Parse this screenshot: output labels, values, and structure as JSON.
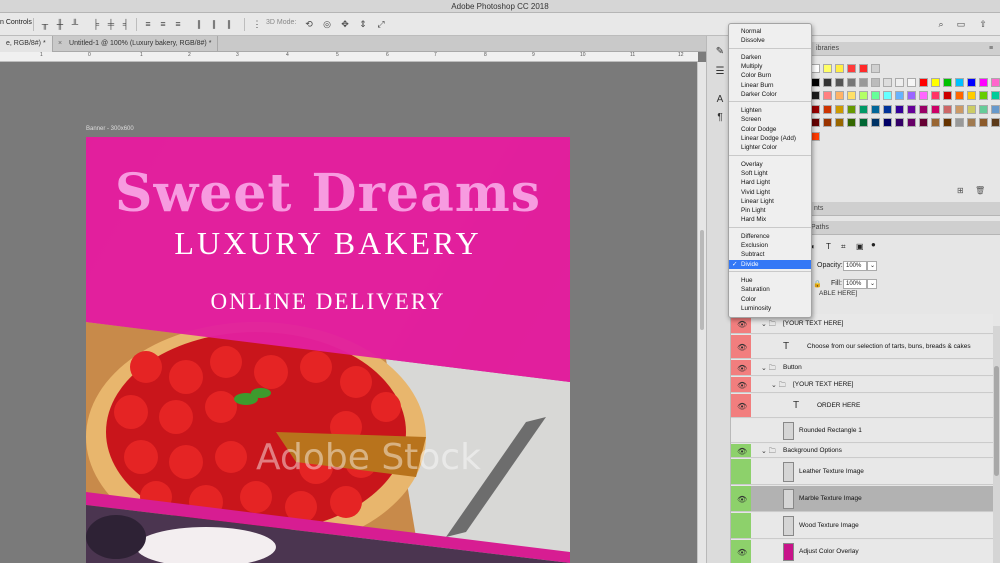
{
  "app": {
    "title": "Adobe Photoshop CC 2018"
  },
  "options_bar": {
    "label_partial": "n Controls",
    "mode_3d": "3D Mode:"
  },
  "tabs": [
    {
      "label": "e, RGB/8#) *",
      "close": ""
    },
    {
      "label": "Untitled-1 @ 100% (Luxury bakery, RGB/8#) *",
      "close": "×"
    }
  ],
  "ruler_labels": [
    "0",
    "1",
    "2",
    "3",
    "4",
    "5",
    "6",
    "7",
    "8",
    "9",
    "10",
    "11",
    "12"
  ],
  "artboard": {
    "label": "Banner - 300x600",
    "title": "Sweet Dreams",
    "subtitle": "LUXURY BAKERY",
    "tagline": "ONLINE DELIVERY",
    "watermark": "Adobe Stock"
  },
  "panels": {
    "top_tab_label_partial": "ibraries",
    "mid_tab_label_partial": "nts",
    "paths_tab_partial": "Paths",
    "opacity_label": "Opacity:",
    "opacity_value": "100%",
    "fill_label": "Fill:",
    "fill_value": "100%",
    "cut_layer_partial": "ABLE HERE]"
  },
  "blend_menu": {
    "groups": [
      [
        "Normal",
        "Dissolve"
      ],
      [
        "Darken",
        "Multiply",
        "Color Burn",
        "Linear Burn",
        "Darker Color"
      ],
      [
        "Lighten",
        "Screen",
        "Color Dodge",
        "Linear Dodge (Add)",
        "Lighter Color"
      ],
      [
        "Overlay",
        "Soft Light",
        "Hard Light",
        "Vivid Light",
        "Linear Light",
        "Pin Light",
        "Hard Mix"
      ],
      [
        "Difference",
        "Exclusion",
        "Subtract",
        "Divide"
      ],
      [
        "Hue",
        "Saturation",
        "Color",
        "Luminosity"
      ]
    ],
    "selected": "Divide"
  },
  "layers": [
    {
      "name": "[YOUR TEXT HERE]",
      "kind": "group",
      "eye": "red",
      "indent": 1
    },
    {
      "name": "Choose from our selection of tarts, buns, breads & cakes",
      "kind": "text",
      "eye": "red",
      "indent": 2
    },
    {
      "name": "Button",
      "kind": "group",
      "eye": "red",
      "indent": 1
    },
    {
      "name": "[YOUR TEXT HERE]",
      "kind": "group",
      "eye": "red",
      "indent": 2
    },
    {
      "name": "ORDER HERE",
      "kind": "text",
      "eye": "red",
      "indent": 3
    },
    {
      "name": "Rounded Rectangle 1",
      "kind": "shape",
      "eye": "none",
      "indent": 2
    },
    {
      "name": "Background Options",
      "kind": "group",
      "eye": "green",
      "indent": 1
    },
    {
      "name": "Leather Texture Image",
      "kind": "image",
      "eye": "green-off",
      "indent": 2
    },
    {
      "name": "Marble Texture Image",
      "kind": "image",
      "eye": "green",
      "indent": 2,
      "selected": true
    },
    {
      "name": "Wood Texture Image",
      "kind": "image",
      "eye": "green-off",
      "indent": 2
    },
    {
      "name": "Adjust Color Overlay",
      "kind": "image",
      "eye": "green",
      "indent": 2
    }
  ],
  "colors": {
    "pink": "#e2209d",
    "title_pink": "#f79be0",
    "red_eye": "#f27e7e",
    "green_eye": "#8dd16b",
    "menu_select": "#3478f6"
  }
}
